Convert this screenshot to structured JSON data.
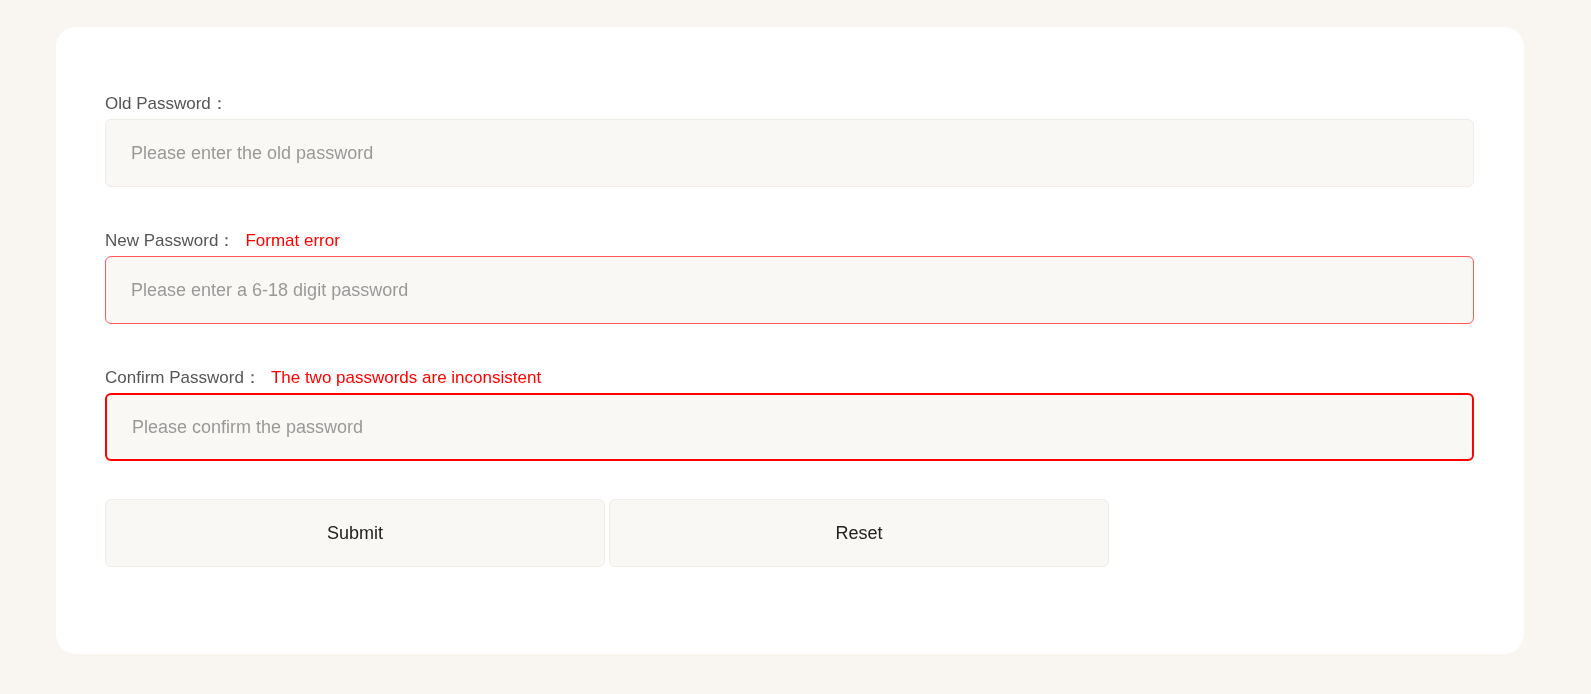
{
  "fields": [
    {
      "label": "Old Password：",
      "placeholder": "Please enter the old password",
      "focused": false
    },
    {
      "label": "New Password：",
      "error": "Format error",
      "placeholder": "Please enter a 6-18 digit password",
      "focused": false
    },
    {
      "label": "Confirm Password：",
      "error": "The two passwords are inconsistent",
      "placeholder": "Please confirm the password",
      "focused": true
    }
  ],
  "buttons": [
    "Submit",
    "Reset"
  ]
}
